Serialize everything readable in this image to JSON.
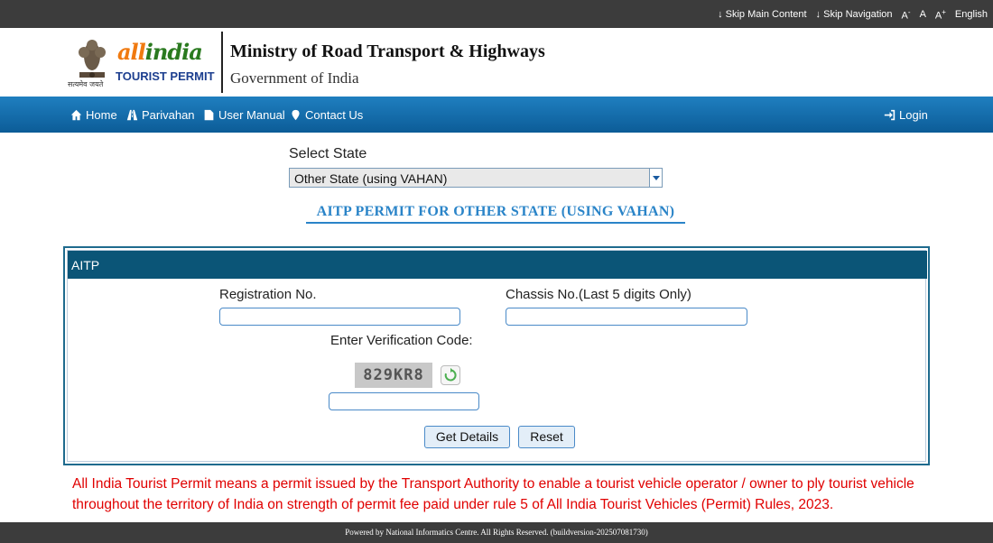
{
  "topbar": {
    "skip_main": "Skip Main Content",
    "skip_nav": "Skip Navigation",
    "font_smaller": "A",
    "font_smaller_sup": "-",
    "font_normal": "A",
    "font_larger": "A",
    "font_larger_sup": "+",
    "language": "English"
  },
  "header": {
    "brand_word_a": "all",
    "brand_word_b": "india",
    "brand_sub": "TOURIST PERMIT",
    "emblem_text": "सत्यमेव जयते",
    "ministry": "Ministry of Road Transport & Highways",
    "government": "Government of India"
  },
  "nav": {
    "home": "Home",
    "parivahan": "Parivahan",
    "user_manual": "User Manual",
    "contact_us": "Contact Us",
    "login": "Login"
  },
  "state": {
    "label": "Select State",
    "selected": "Other State (using VAHAN)"
  },
  "permit_title": "AITP PERMIT FOR OTHER STATE (USING VAHAN)",
  "form": {
    "header": "AITP",
    "registration_label": "Registration No.",
    "registration_value": "",
    "chassis_label": "Chassis No.(Last 5 digits Only)",
    "chassis_value": "",
    "verification_label": "Enter Verification Code:",
    "captcha_text": "829KR8",
    "verification_value": "",
    "get_details": "Get Details",
    "reset": "Reset"
  },
  "notice": "All India Tourist Permit means a permit issued by the Transport Authority to enable a tourist vehicle operator / owner to ply tourist vehicle throughout the territory of India on strength of permit fee paid under rule 5 of All India Tourist Vehicles (Permit) Rules, 2023.",
  "footer": "Powered by National Informatics Centre. All Rights Reserved. (buildversion-202507081730)",
  "colors": {
    "nav_bar": "#0c5c97",
    "panel_header": "#0b5577",
    "notice_text": "#e00000",
    "title_blue": "#2a84c8"
  }
}
